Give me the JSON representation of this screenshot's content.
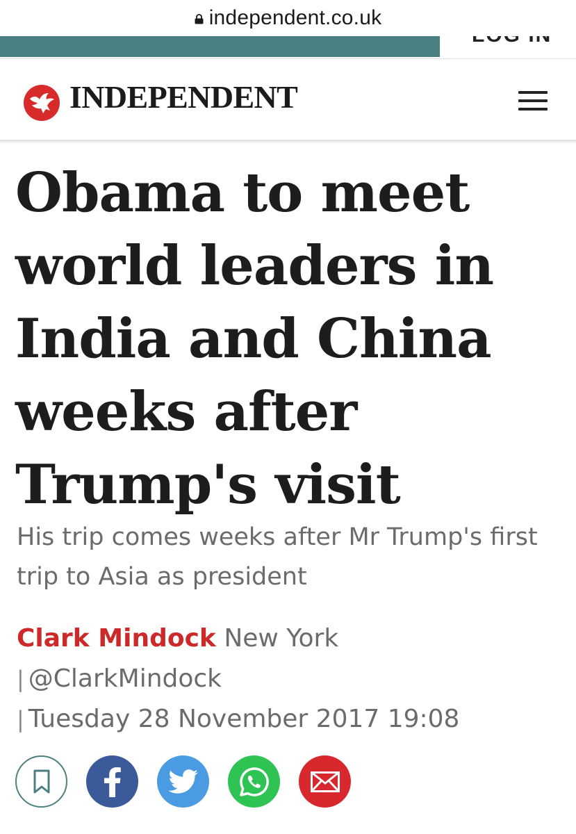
{
  "browser": {
    "url": "independent.co.uk"
  },
  "topbar": {
    "login_label": "LOG IN"
  },
  "header": {
    "brand": "INDEPENDENT"
  },
  "article": {
    "headline": "Obama to meet world leaders in India and China weeks after Trump's visit",
    "standfirst": "His trip comes weeks after Mr Trump's first trip to Asia as president",
    "author": "Clark Mindock",
    "location": "New York",
    "separator": "|",
    "twitter_handle": "@ClarkMindock",
    "date": "Tuesday 28 November 2017 19:08"
  },
  "share": [
    {
      "icon": "bookmark-icon",
      "color": "#4d7f80"
    },
    {
      "icon": "facebook-icon",
      "color": "#3b5a99"
    },
    {
      "icon": "twitter-icon",
      "color": "#4b9be2"
    },
    {
      "icon": "whatsapp-icon",
      "color": "#2fc353"
    },
    {
      "icon": "email-icon",
      "color": "#d8282d"
    }
  ],
  "colors": {
    "accent_red": "#cc2a2a",
    "teal": "#4a8082"
  }
}
